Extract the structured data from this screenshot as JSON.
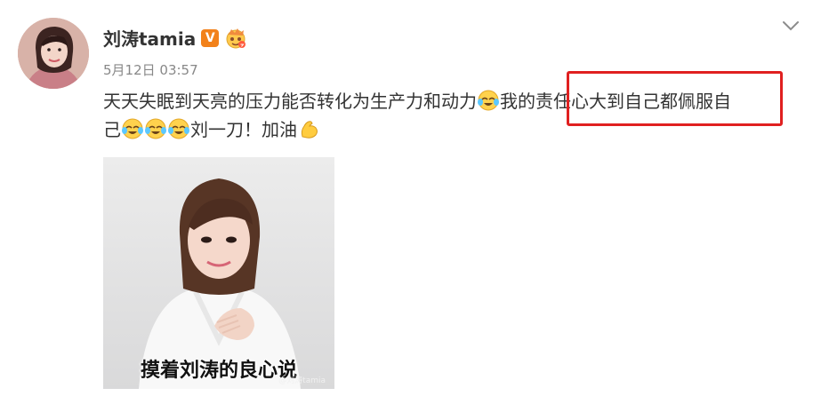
{
  "post": {
    "username": "刘涛tamia",
    "verified_badge": "V",
    "timestamp": "5月12日 03:57",
    "text_line1": "天天失眠到天亮的压力能否转化为生产力和动力",
    "text_mid": "我的责任心大到自己都佩服自",
    "text_line2_start": "己",
    "text_line2_end": "刘一刀！加油",
    "image_caption": "摸着刘涛的良心说",
    "image_watermark": "@刘涛tamia"
  },
  "icons": {
    "badge": "verified-v-icon",
    "face": "crown-face-icon",
    "emoji_cry": "laughing-tears-emoji",
    "emoji_strong": "flexed-biceps-emoji",
    "menu": "chevron-down-icon"
  },
  "colors": {
    "highlight_border": "#e02020",
    "badge": "#f2811a",
    "text": "#333333",
    "meta": "#888888"
  }
}
